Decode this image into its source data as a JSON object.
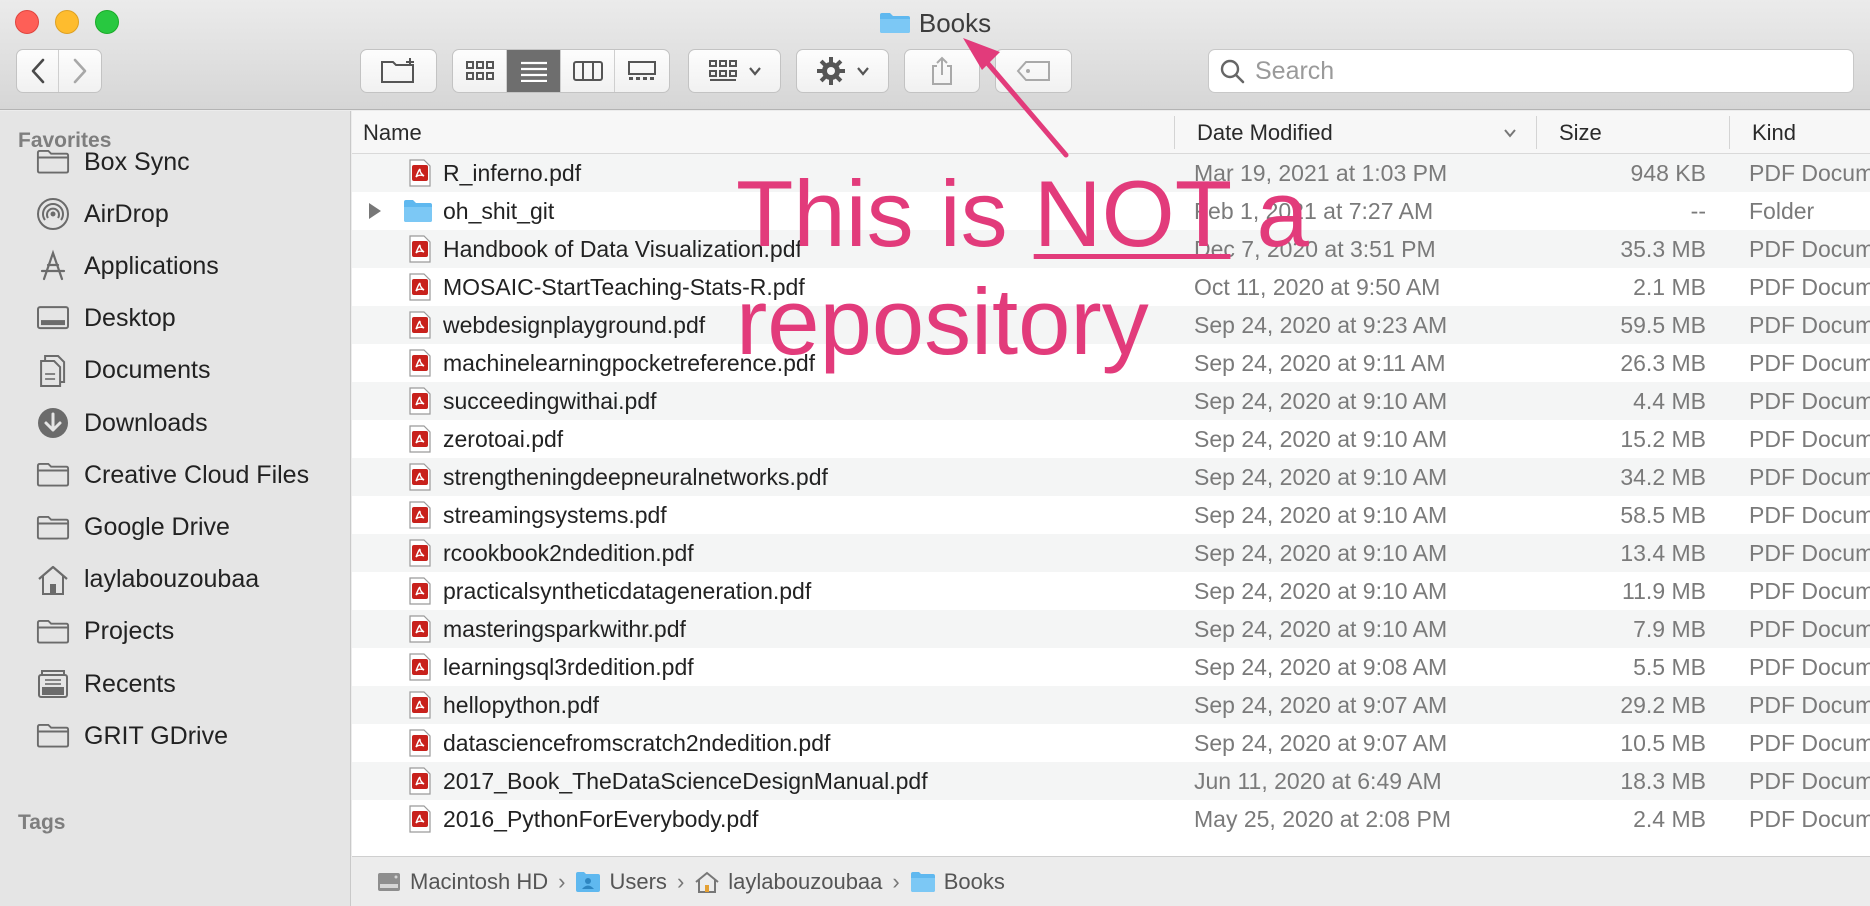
{
  "window": {
    "title": "Books",
    "title_icon": "folder-icon"
  },
  "toolbar": {
    "back_icon": "chevron-left-icon",
    "forward_icon": "chevron-right-icon",
    "new_folder_icon": "new-folder-icon",
    "view_modes": [
      "icon-view-icon",
      "list-view-icon",
      "column-view-icon",
      "gallery-view-icon"
    ],
    "active_view": "list-view-icon",
    "group_icon": "group-by-icon",
    "action_icon": "gear-icon",
    "share_icon": "share-icon",
    "tag_icon": "tag-icon",
    "search_placeholder": "Search"
  },
  "sidebar": {
    "favorites_heading": "Favorites",
    "items": [
      {
        "label": "Box Sync",
        "icon": "folder-icon"
      },
      {
        "label": "AirDrop",
        "icon": "airdrop-icon"
      },
      {
        "label": "Applications",
        "icon": "applications-icon"
      },
      {
        "label": "Desktop",
        "icon": "desktop-icon"
      },
      {
        "label": "Documents",
        "icon": "documents-icon"
      },
      {
        "label": "Downloads",
        "icon": "downloads-icon"
      },
      {
        "label": "Creative Cloud Files",
        "icon": "folder-icon"
      },
      {
        "label": "Google Drive",
        "icon": "folder-icon"
      },
      {
        "label": "laylabouzoubaa",
        "icon": "home-icon"
      },
      {
        "label": "Projects",
        "icon": "folder-icon"
      },
      {
        "label": "Recents",
        "icon": "recents-icon"
      },
      {
        "label": "GRIT GDrive",
        "icon": "folder-icon"
      }
    ],
    "tags_heading": "Tags"
  },
  "columns": {
    "name": "Name",
    "date": "Date Modified",
    "size": "Size",
    "kind": "Kind",
    "sort_indicator_icon": "chevron-down-icon"
  },
  "files": [
    {
      "name": "R_inferno.pdf",
      "date": "Mar 19, 2021 at 1:03 PM",
      "size": "948 KB",
      "kind": "PDF Docum",
      "type": "pdf"
    },
    {
      "name": "oh_shit_git",
      "date": "Feb 1, 2021 at 7:27 AM",
      "size": "--",
      "kind": "Folder",
      "type": "folder"
    },
    {
      "name": "Handbook of Data Visualization.pdf",
      "date": "Dec 7, 2020 at 3:51 PM",
      "size": "35.3 MB",
      "kind": "PDF Docum",
      "type": "pdf"
    },
    {
      "name": "MOSAIC-StartTeaching-Stats-R.pdf",
      "date": "Oct 11, 2020 at 9:50 AM",
      "size": "2.1 MB",
      "kind": "PDF Docum",
      "type": "pdf"
    },
    {
      "name": "webdesignplayground.pdf",
      "date": "Sep 24, 2020 at 9:23 AM",
      "size": "59.5 MB",
      "kind": "PDF Docum",
      "type": "pdf"
    },
    {
      "name": "machinelearningpocketreference.pdf",
      "date": "Sep 24, 2020 at 9:11 AM",
      "size": "26.3 MB",
      "kind": "PDF Docum",
      "type": "pdf"
    },
    {
      "name": "succeedingwithai.pdf",
      "date": "Sep 24, 2020 at 9:10 AM",
      "size": "4.4 MB",
      "kind": "PDF Docum",
      "type": "pdf"
    },
    {
      "name": "zerotoai.pdf",
      "date": "Sep 24, 2020 at 9:10 AM",
      "size": "15.2 MB",
      "kind": "PDF Docum",
      "type": "pdf"
    },
    {
      "name": "strengtheningdeepneuralnetworks.pdf",
      "date": "Sep 24, 2020 at 9:10 AM",
      "size": "34.2 MB",
      "kind": "PDF Docum",
      "type": "pdf"
    },
    {
      "name": "streamingsystems.pdf",
      "date": "Sep 24, 2020 at 9:10 AM",
      "size": "58.5 MB",
      "kind": "PDF Docum",
      "type": "pdf"
    },
    {
      "name": "rcookbook2ndedition.pdf",
      "date": "Sep 24, 2020 at 9:10 AM",
      "size": "13.4 MB",
      "kind": "PDF Docum",
      "type": "pdf"
    },
    {
      "name": "practicalsyntheticdatageneration.pdf",
      "date": "Sep 24, 2020 at 9:10 AM",
      "size": "11.9 MB",
      "kind": "PDF Docum",
      "type": "pdf"
    },
    {
      "name": "masteringsparkwithr.pdf",
      "date": "Sep 24, 2020 at 9:10 AM",
      "size": "7.9 MB",
      "kind": "PDF Docum",
      "type": "pdf"
    },
    {
      "name": "learningsql3rdedition.pdf",
      "date": "Sep 24, 2020 at 9:08 AM",
      "size": "5.5 MB",
      "kind": "PDF Docum",
      "type": "pdf"
    },
    {
      "name": "hellopython.pdf",
      "date": "Sep 24, 2020 at 9:07 AM",
      "size": "29.2 MB",
      "kind": "PDF Docum",
      "type": "pdf"
    },
    {
      "name": "datasciencefromscratch2ndedition.pdf",
      "date": "Sep 24, 2020 at 9:07 AM",
      "size": "10.5 MB",
      "kind": "PDF Docum",
      "type": "pdf"
    },
    {
      "name": "2017_Book_TheDataScienceDesignManual.pdf",
      "date": "Jun 11, 2020 at 6:49 AM",
      "size": "18.3 MB",
      "kind": "PDF Docum",
      "type": "pdf"
    },
    {
      "name": "2016_PythonForEverybody.pdf",
      "date": "May 25, 2020 at 2:08 PM",
      "size": "2.4 MB",
      "kind": "PDF Docum",
      "type": "pdf"
    }
  ],
  "pathbar": {
    "crumbs": [
      {
        "label": "Macintosh HD",
        "icon": "hard-drive-icon"
      },
      {
        "label": "Users",
        "icon": "users-folder-icon"
      },
      {
        "label": "laylabouzoubaa",
        "icon": "home-icon"
      },
      {
        "label": "Books",
        "icon": "folder-icon"
      }
    ]
  },
  "annotation": {
    "line1_prefix": "This is ",
    "line1_emph": "NOT",
    "line1_suffix": " a",
    "line2": "repository",
    "color": "#e23b7b"
  }
}
